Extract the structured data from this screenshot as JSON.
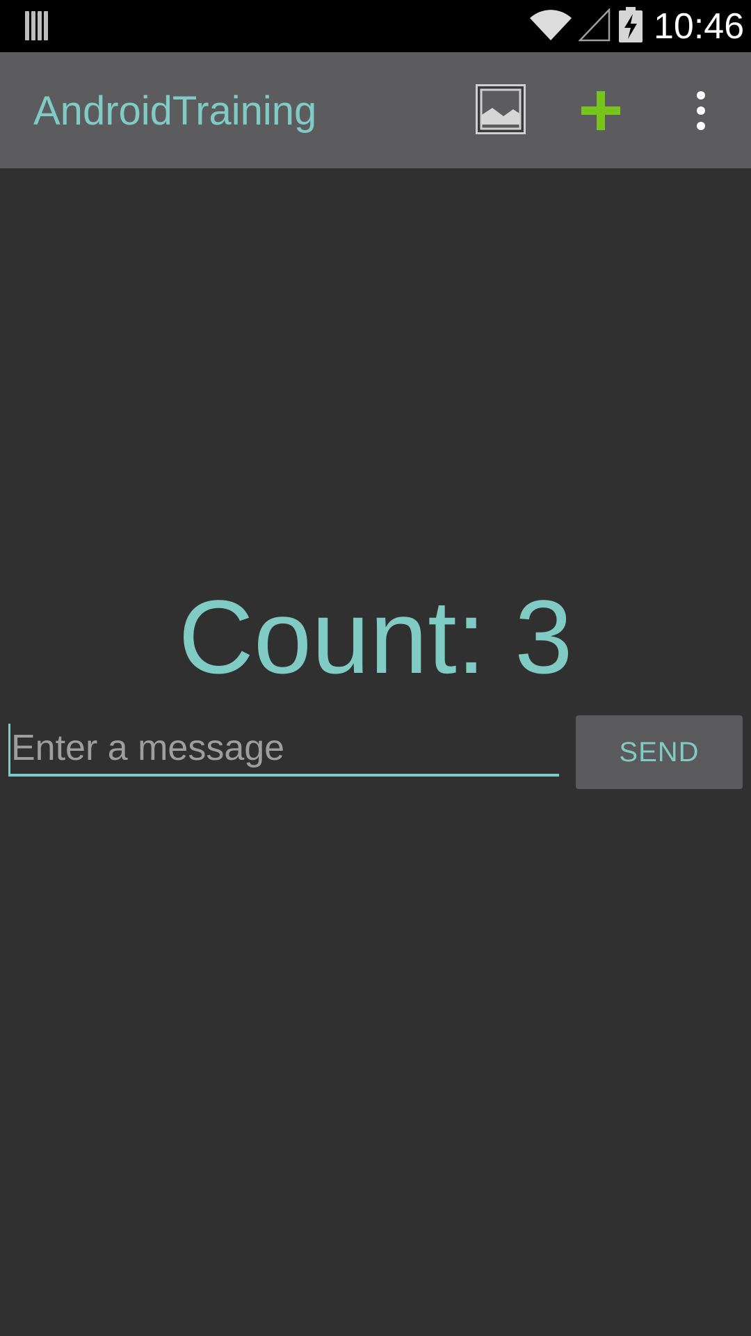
{
  "status_bar": {
    "time": "10:46",
    "icons": [
      "barcode-icon",
      "wifi-icon",
      "signal-icon",
      "battery-charging-icon"
    ]
  },
  "action_bar": {
    "title": "AndroidTraining",
    "actions": [
      "image-icon",
      "add-icon",
      "overflow-menu-icon"
    ]
  },
  "main": {
    "count_text": "Count: 3",
    "message_placeholder": "Enter a message",
    "send_label": "SEND"
  },
  "colors": {
    "accent": "#80cbc4",
    "background": "#303030",
    "action_bar": "#5c5c5e",
    "add_icon": "#76c41c"
  }
}
